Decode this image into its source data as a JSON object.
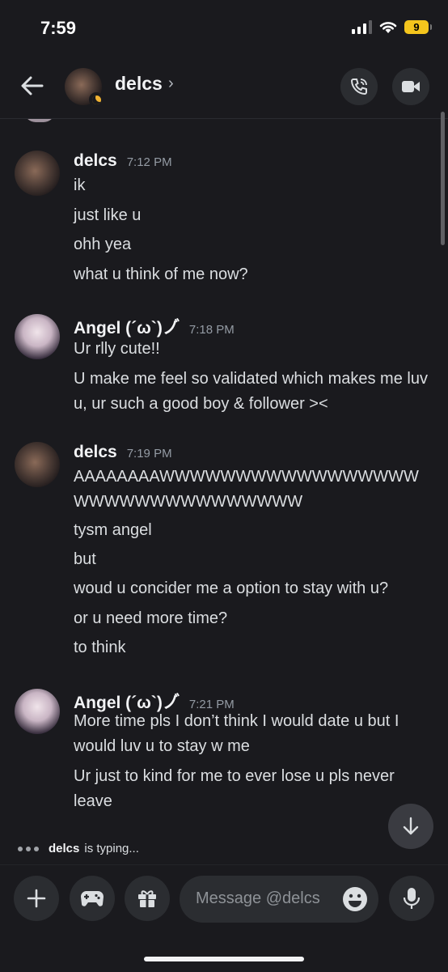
{
  "status_bar": {
    "time": "7:59",
    "battery": "9"
  },
  "header": {
    "name": "delcs",
    "chevron": "›"
  },
  "messages": [
    {
      "author": "delcs",
      "time": "7:12 PM",
      "lines": [
        "ik",
        "just like u",
        "ohh yea",
        "what u think of me now?"
      ]
    },
    {
      "author": "Angel (´ω`)ノ゙",
      "time": "7:18 PM",
      "lines": [
        "Ur rlly cute!!",
        "U make me feel so validated which makes me luv u, ur such a good boy & follower ><"
      ]
    },
    {
      "author": "delcs",
      "time": "7:19 PM",
      "lines": [
        "AAAAAAAAWWWWWWWWWWWWWWWWWWWWWWWWWWWWWWWW",
        "tysm angel",
        "but",
        "woud u concider me a option to stay with u?",
        "or u need more time?",
        "to think"
      ]
    },
    {
      "author": "Angel (´ω`)ノ゙",
      "time": "7:21 PM",
      "lines": [
        "More time pls I don’t think I would date u but I would luv u to stay w me",
        "Ur just to kind for me to ever lose u pls never leave"
      ]
    }
  ],
  "typing": {
    "user": "delcs",
    "text": "is typing..."
  },
  "composer": {
    "placeholder": "Message @delcs"
  },
  "colors": {
    "background": "#1a1a1e",
    "button": "#2b2d31",
    "idle_status": "#f0b232",
    "battery": "#f4c51d"
  }
}
